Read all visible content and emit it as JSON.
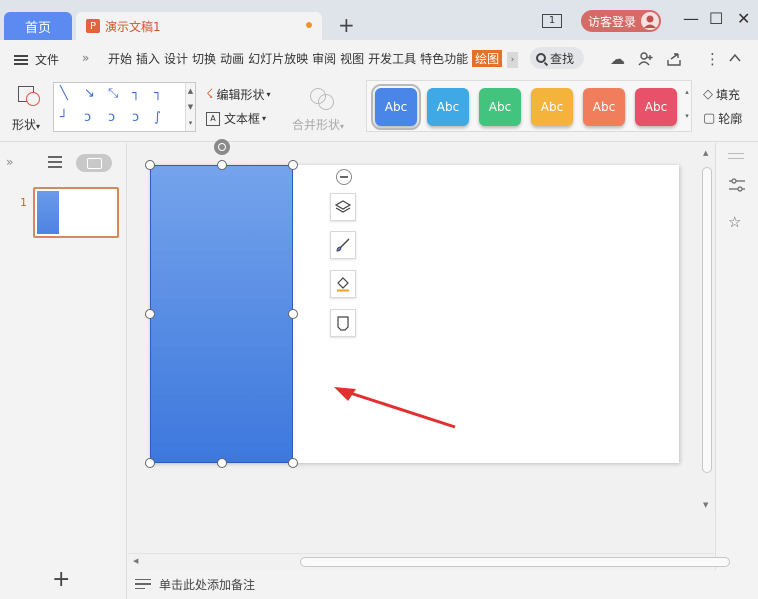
{
  "titlebar": {
    "home_tab": "首页",
    "doc_icon": "P",
    "doc_title": "演示文稿1",
    "new_tab": "+",
    "window_count": "1",
    "guest_login": "访客登录"
  },
  "menubar": {
    "file": "文件",
    "items": [
      "开始",
      "插入",
      "设计",
      "切换",
      "动画",
      "幻灯片放映",
      "审阅",
      "视图",
      "开发工具",
      "特色功能",
      "绘图"
    ],
    "active_item": "绘图",
    "search": "查找"
  },
  "ribbon": {
    "shape": "形状",
    "edit_shape": "编辑形状",
    "textbox": "文本框",
    "merge_shape": "合并形状",
    "style_label": "Abc",
    "style_colors": [
      "#4a86e8",
      "#3fa9e6",
      "#43c47e",
      "#f4b33a",
      "#f07e5c",
      "#e8516a"
    ],
    "fill": "填充",
    "outline": "轮廓"
  },
  "left_panel": {
    "slide_number": "1",
    "add": "+"
  },
  "notes": {
    "placeholder": "单击此处添加备注"
  },
  "colors": {
    "accent": "#e0722e",
    "home_tab": "#5b8bf0",
    "shape_fill": "#4d83e3",
    "arrow": "#e0312e"
  }
}
